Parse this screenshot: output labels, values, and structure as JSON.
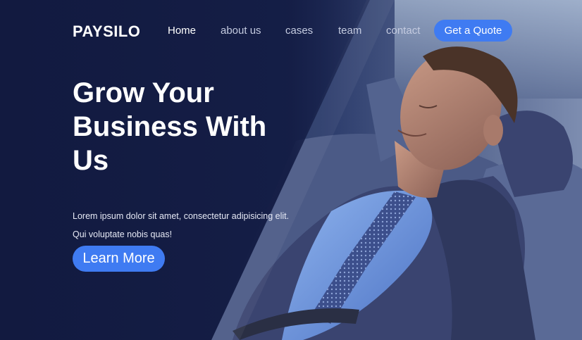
{
  "nav": {
    "brand": "PAYSILO",
    "links": [
      "Home",
      "about us",
      "cases",
      "team",
      "contact"
    ],
    "active_link": "Home",
    "cta_label": "Get a Quote"
  },
  "hero": {
    "headline_lines": [
      "Grow Your",
      "Business With",
      "Us"
    ],
    "description_lines": [
      "Lorem ipsum dolor sit amet, consectetur adipisicing elit.",
      "Qui voluptate nobis quas!"
    ],
    "button_label": "Learn More",
    "image_icon": "relaxed-businessman-photo"
  },
  "colors": {
    "accent": "#3f7bf2",
    "background": "#141d45",
    "text": "#ffffff"
  }
}
